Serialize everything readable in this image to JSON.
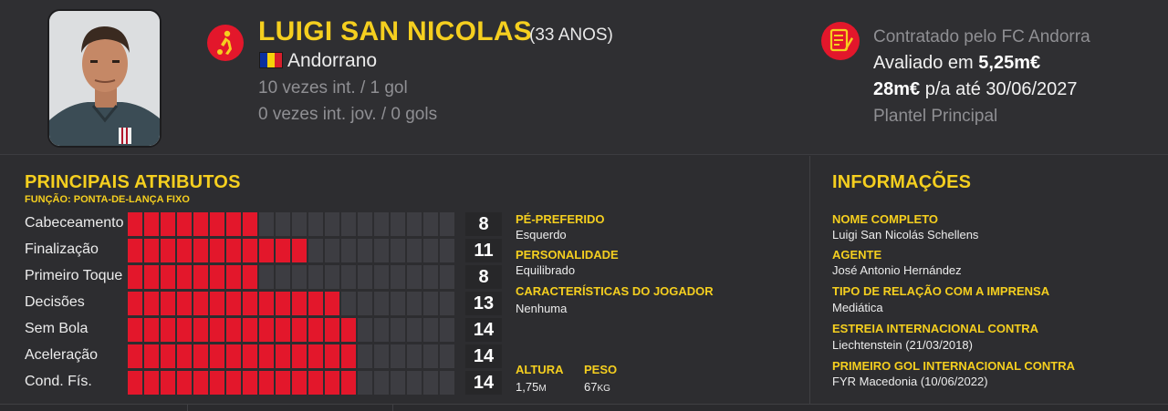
{
  "player": {
    "name": "LUIGI SAN NICOLAS",
    "age": "(33 ANOS)",
    "nationality": "Andorrano",
    "caps": "10 vezes int. / 1 gol",
    "youth_caps": "0 vezes int. jov. / 0 gols",
    "flag_colors": [
      "#0a2f9e",
      "#f5d20a",
      "#d61e2b"
    ],
    "position_icon": "football-player-icon"
  },
  "contract": {
    "icon": "contract-icon",
    "signed_by": "Contratado pelo FC Andorra",
    "value_prefix": "Avaliado em ",
    "value": "5,25m€",
    "wage": "28m€",
    "wage_suffix": " p/a até 30/06/2027",
    "squad": "Plantel Principal"
  },
  "attributes": {
    "title": "PRINCIPAIS ATRIBUTOS",
    "role": "FUNÇÃO: PONTA-DE-LANÇA FIXO",
    "max": 20,
    "accent": "#e3172b",
    "items": [
      {
        "label": "Cabeceamento",
        "value": 8
      },
      {
        "label": "Finalização",
        "value": 11
      },
      {
        "label": "Primeiro Toque",
        "value": 8
      },
      {
        "label": "Decisões",
        "value": 13
      },
      {
        "label": "Sem Bola",
        "value": 14
      },
      {
        "label": "Aceleração",
        "value": 14
      },
      {
        "label": "Cond. Fís.",
        "value": 14
      }
    ]
  },
  "traits": {
    "foot_label": "PÉ-PREFERIDO",
    "foot_value": "Esquerdo",
    "personality_label": "PERSONALIDADE",
    "personality_value": "Equilibrado",
    "characteristics_label": "CARACTERÍSTICAS DO JOGADOR",
    "characteristics_value": "Nenhuma",
    "height_label": "ALTURA",
    "height_value": "1,75",
    "height_unit": "M",
    "weight_label": "PESO",
    "weight_value": "67",
    "weight_unit": "KG"
  },
  "info": {
    "title": "INFORMAÇÕES",
    "items": [
      {
        "label": "NOME COMPLETO",
        "value": "Luigi San Nicolás Schellens"
      },
      {
        "label": "AGENTE",
        "value": "José Antonio Hernández"
      },
      {
        "label": "TIPO DE RELAÇÃO COM A IMPRENSA",
        "value": "Mediática"
      },
      {
        "label": "ESTREIA INTERNACIONAL CONTRA",
        "value": "Liechtenstein (21/03/2018)"
      },
      {
        "label": "PRIMEIRO GOL INTERNACIONAL CONTRA",
        "value": "FYR Macedonia (10/06/2022)"
      }
    ]
  },
  "colors": {
    "accent_yellow": "#f5cf1f",
    "accent_red": "#e3172b",
    "background": "#2d2d30"
  }
}
